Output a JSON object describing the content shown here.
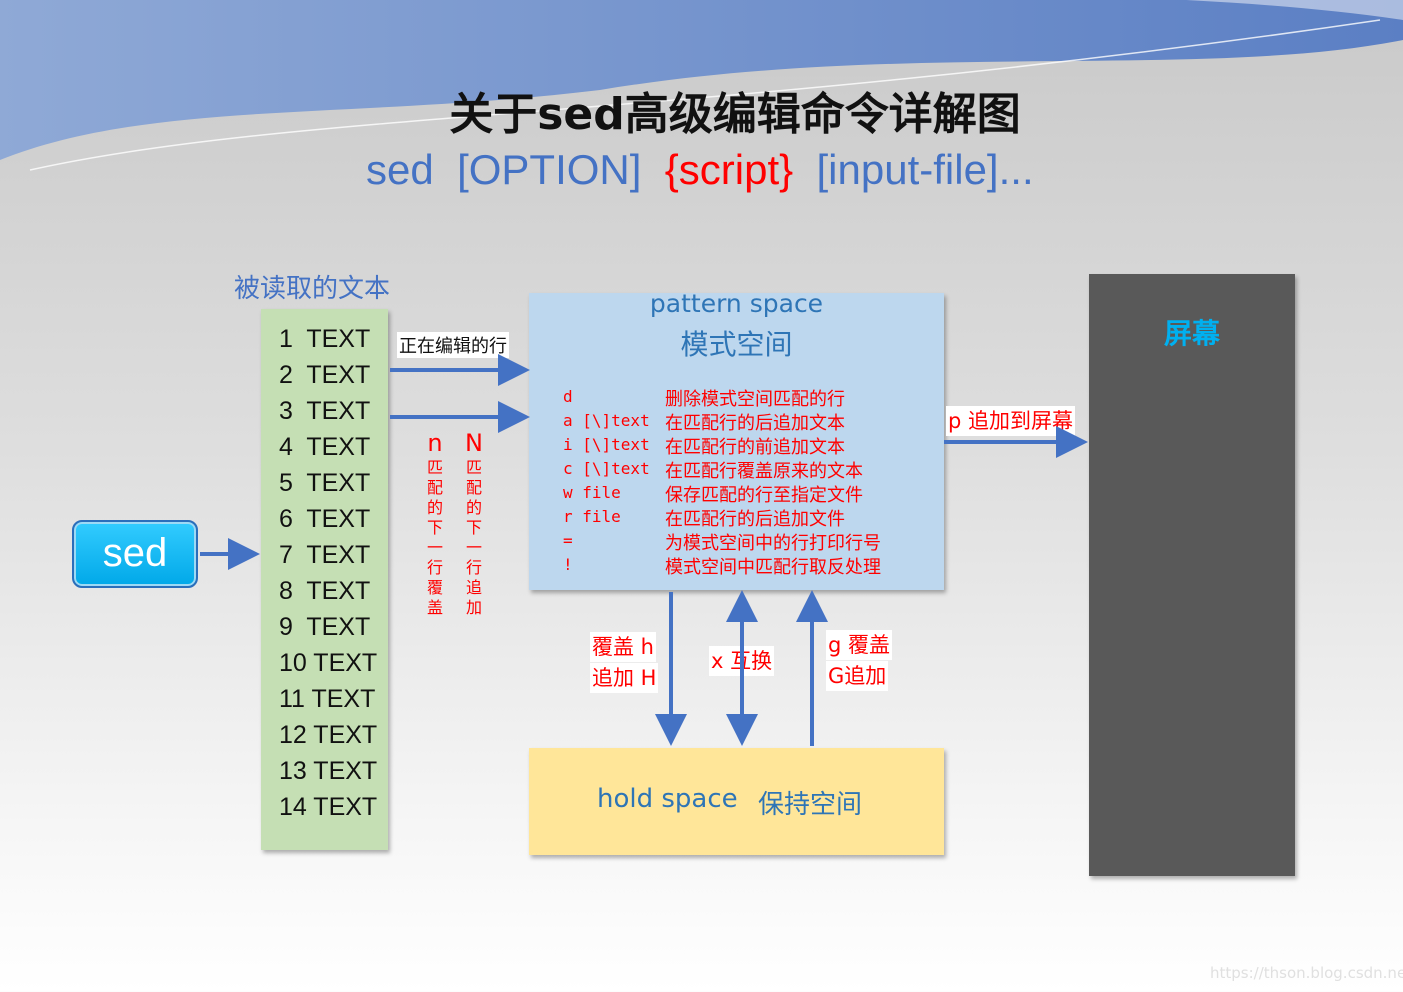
{
  "title": "关于sed高级编辑命令详解图",
  "syntax": {
    "sed": "sed",
    "option": "[OPTION]",
    "script": "{script}",
    "input": "[input-file]..."
  },
  "read_label": "被读取的文本",
  "lines": [
    "1  TEXT",
    "2  TEXT",
    "3  TEXT",
    "4  TEXT",
    "5  TEXT",
    "6  TEXT",
    "7  TEXT",
    "8  TEXT",
    "9  TEXT",
    "10 TEXT",
    "11 TEXT",
    "12 TEXT",
    "13 TEXT",
    "14 TEXT"
  ],
  "editing_label": "正在编辑的行",
  "n_label": {
    "letter": "n",
    "text": [
      "匹",
      "配",
      "的",
      "下",
      "一",
      "行",
      "覆",
      "盖"
    ]
  },
  "N_label": {
    "letter": "N",
    "text": [
      "匹",
      "配",
      "的",
      "下",
      "一",
      "行",
      "追",
      "加"
    ]
  },
  "sed_button": "sed",
  "pattern": {
    "title_en": "pattern space",
    "title_cn": "模式空间",
    "commands": [
      {
        "cmd": "d",
        "desc": "删除模式空间匹配的行"
      },
      {
        "cmd": "a [\\]text",
        "desc": "在匹配行的后追加文本"
      },
      {
        "cmd": "i [\\]text",
        "desc": "在匹配行的前追加文本"
      },
      {
        "cmd": "c [\\]text",
        "desc": "在匹配行覆盖原来的文本"
      },
      {
        "cmd": "w file",
        "desc": "保存匹配的行至指定文件"
      },
      {
        "cmd": "r file",
        "desc": "在匹配行的后追加文件"
      },
      {
        "cmd": "=",
        "desc": "为模式空间中的行打印行号"
      },
      {
        "cmd": "!",
        "desc": "模式空间中匹配行取反处理"
      }
    ]
  },
  "p_label": "p 追加到屏幕",
  "hold": {
    "en": "hold space",
    "cn": "保持空间"
  },
  "hH_label": [
    "覆盖 h",
    "追加 H"
  ],
  "x_label": "x 互换",
  "gG_label": [
    "g 覆盖",
    "G追加"
  ],
  "screen_label": "屏幕",
  "watermark": "https://thson.blog.csdn.net",
  "colors": {
    "accent": "#4472c4",
    "red": "#ff0000",
    "pattern_bg": "#bdd7ee",
    "hold_bg": "#ffe699",
    "text_bg": "#c5dfb4",
    "screen_bg": "#595959"
  }
}
